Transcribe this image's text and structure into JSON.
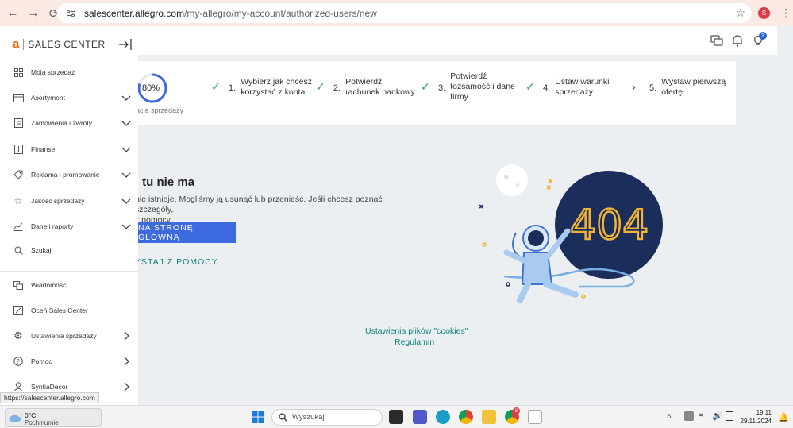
{
  "browser": {
    "url_host": "salescenter.allegro.com",
    "url_path": "/my-allegro/my-account/authorized-users/new",
    "profile_initial": "S"
  },
  "topbar": {
    "notification_count": "3"
  },
  "progress": {
    "percent_label": "80%",
    "percent": 80,
    "caption": "racja sprzedaży",
    "steps": [
      {
        "num": "1.",
        "text": "Wybierz jak chcesz korzystać z konta",
        "done": true
      },
      {
        "num": "2.",
        "text": "Potwierdź rachunek bankowy",
        "done": true
      },
      {
        "num": "3.",
        "text": "Potwierdź tożsamość i dane firmy",
        "done": true
      },
      {
        "num": "4.",
        "text": "Ustaw warunki sprzedaży",
        "done": true
      },
      {
        "num": "5.",
        "text": "Wystaw pierwszą ofertę",
        "done": false
      }
    ]
  },
  "error": {
    "title": ": tu nie ma",
    "description_line1": "nie istnieje. Mogliśmy ją usunąć lub przenieść. Jeśli chcesz poznać szczegóły,",
    "description_line2": "z pomocy.",
    "home_button": "NA STRONĘ GŁÓWNĄ",
    "help_link": "YSTAJ Z POMOCY",
    "illustration_text": "404"
  },
  "footer": {
    "cookies": "Ustawienia plików \"cookies\"",
    "terms": "Regulamin"
  },
  "sidebar": {
    "logo_letter": "a",
    "logo_text": "SALES CENTER",
    "items": [
      {
        "label": "Moja sprzedaż",
        "icon": "grid-icon"
      },
      {
        "label": "Asortyment",
        "icon": "box-icon"
      },
      {
        "label": "Zamówienia i zwroty",
        "icon": "orders-icon"
      },
      {
        "label": "Finanse",
        "icon": "finance-icon"
      },
      {
        "label": "Reklama i promowanie",
        "icon": "tag-icon"
      },
      {
        "label": "Jakość sprzedaży",
        "icon": "star-icon"
      },
      {
        "label": "Dane i raporty",
        "icon": "chart-icon"
      },
      {
        "label": "Szukaj",
        "icon": "search-icon"
      }
    ],
    "bottom_items": [
      {
        "label": "Wiadomości",
        "icon": "messages-icon"
      },
      {
        "label": "Oceń Sales Center",
        "icon": "feedback-icon"
      },
      {
        "label": "Ustawienia sprzedaży",
        "icon": "gear-icon"
      },
      {
        "label": "Pomoc",
        "icon": "help-icon"
      },
      {
        "label": "SyntiaDecor",
        "icon": "user-icon"
      }
    ]
  },
  "status_tooltip": "https://salescenter.allegro.com",
  "taskbar": {
    "temperature": "0°C",
    "weather": "Pochmurnie",
    "search_placeholder": "Wyszukaj",
    "time": "19:11",
    "date": "29.11.2024",
    "chrome_badge": "S"
  }
}
